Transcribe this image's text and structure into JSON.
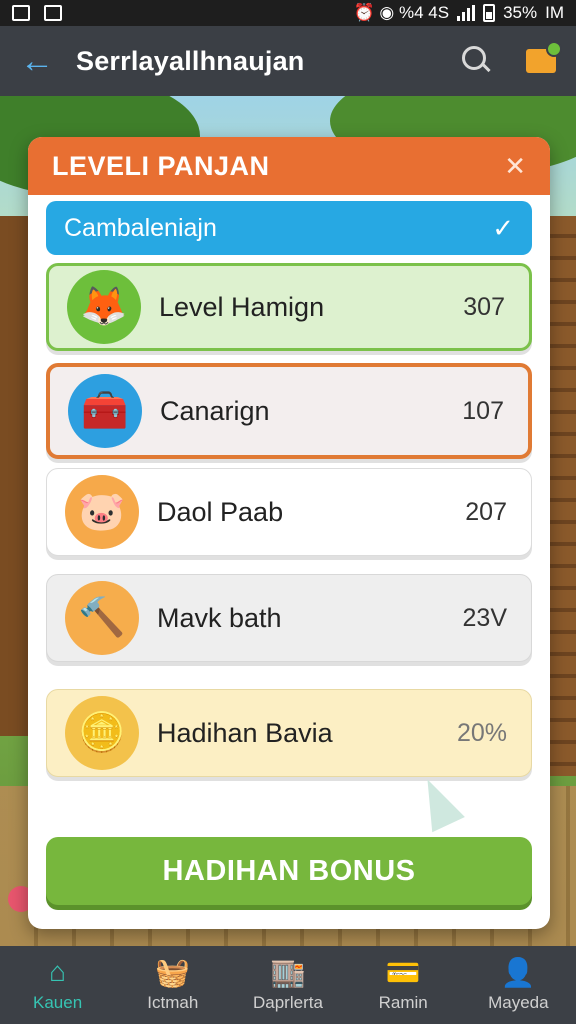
{
  "status_bar": {
    "right_text": "⏰ ◉ %4 4S",
    "battery": "35%",
    "time": "IM"
  },
  "appbar": {
    "title": "Serrlayallhnaujan"
  },
  "dialog": {
    "title": "LEVELI PANJAN",
    "close_glyph": "✕",
    "selected_bar": {
      "label": "Cambaleniajn",
      "check_glyph": "✓"
    },
    "items": [
      {
        "label": "Level Hamign",
        "value": "307",
        "icon": "fox-icon",
        "glyph": "🦊"
      },
      {
        "label": "Canarign",
        "value": "107",
        "icon": "treasure-chest-icon",
        "glyph": "🧰"
      },
      {
        "label": "Daol Paab",
        "value": "207",
        "icon": "piggy-bank-icon",
        "glyph": "🐷"
      },
      {
        "label": "Mavk bath",
        "value": "23V",
        "icon": "hammer-icon",
        "glyph": "🔨"
      },
      {
        "label": "Hadihan Bavia",
        "value": "20%",
        "icon": "coins-icon",
        "glyph": "🪙"
      }
    ],
    "bonus_button": "HADIHAN BONUS"
  },
  "bottom_nav": [
    {
      "label": "Kauen",
      "icon": "home-icon",
      "glyph": "⌂",
      "active": true
    },
    {
      "label": "Ictmah",
      "icon": "basket-icon",
      "glyph": "🧺",
      "active": false
    },
    {
      "label": "Daprlerta",
      "icon": "shop-icon",
      "glyph": "🏬",
      "active": false
    },
    {
      "label": "Ramin",
      "icon": "card-icon",
      "glyph": "💳",
      "active": false
    },
    {
      "label": "Mayeda",
      "icon": "profile-icon",
      "glyph": "👤",
      "active": false
    }
  ],
  "colors": {
    "header": "#e86f32",
    "selected": "#27a8e3",
    "bonus": "#77b73d",
    "nav_active": "#36c4b3"
  }
}
